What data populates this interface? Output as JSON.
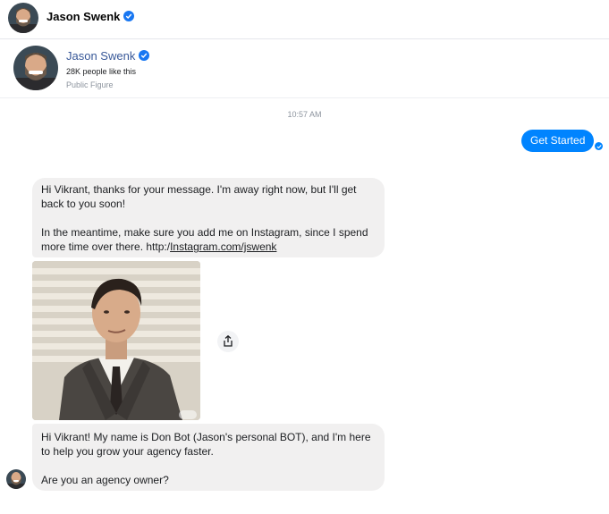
{
  "header": {
    "name": "Jason Swenk",
    "verified_icon": "verified-badge-icon"
  },
  "profile": {
    "name": "Jason Swenk",
    "likes": "28K people like this",
    "category": "Public Figure"
  },
  "conversation": {
    "timestamp": "10:57 AM",
    "outgoing": {
      "text": "Get Started"
    },
    "messages": [
      {
        "line1": "Hi Vikrant, thanks for your message. I'm away  right now, but I'll get back to you soon!\n\nIn the meantime, make sure you add me on Instagram, since I spend more time over there. http:/",
        "link": "Instagram.com/jswenk"
      },
      {
        "text": "Hi Vikrant!  My name is Don Bot (Jason's personal BOT), and I'm here to help you grow your agency faster.\n\nAre you an agency owner?"
      }
    ]
  },
  "colors": {
    "accent": "#0084ff",
    "bubble_incoming": "#f1f0f0",
    "page_link": "#385898",
    "verified": "#1877f2"
  }
}
